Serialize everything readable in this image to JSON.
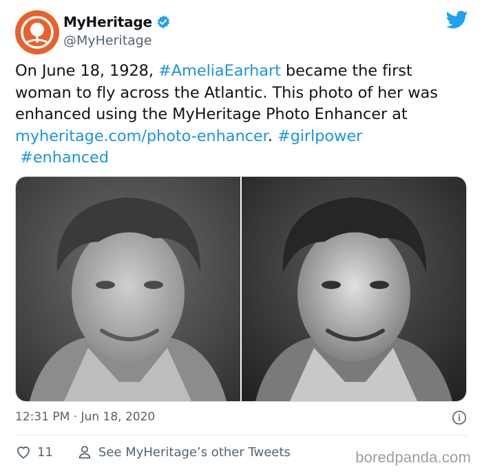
{
  "tweet": {
    "author_name": "MyHeritage",
    "author_handle": "@MyHeritage",
    "text_before": "On June 18, 1928, ",
    "hashtag_1": "#AmeliaEarhart",
    "text_middle": " became the first woman to fly across the Atlantic. This photo of her was enhanced using the MyHeritage Photo Enhancer at ",
    "link": "myheritage.com/photo-enhancer",
    "text_after": ". ",
    "hashtag_2": "#girlpower",
    "hashtag_3": "#enhanced",
    "time": "12:31 PM",
    "separator": " · ",
    "date": "Jun 18, 2020",
    "likes": "11",
    "other_tweets": "See MyHeritage’s other Tweets"
  },
  "watermark": "boredpanda.com",
  "colors": {
    "link": "#1b95e0",
    "avatar": "#e8612c",
    "twitter_blue": "#1da1f2",
    "muted": "#536471"
  },
  "icons": {
    "verified": "verified-badge-icon",
    "bird": "twitter-bird-icon",
    "info": "info-icon",
    "heart": "heart-icon",
    "person": "person-icon"
  }
}
